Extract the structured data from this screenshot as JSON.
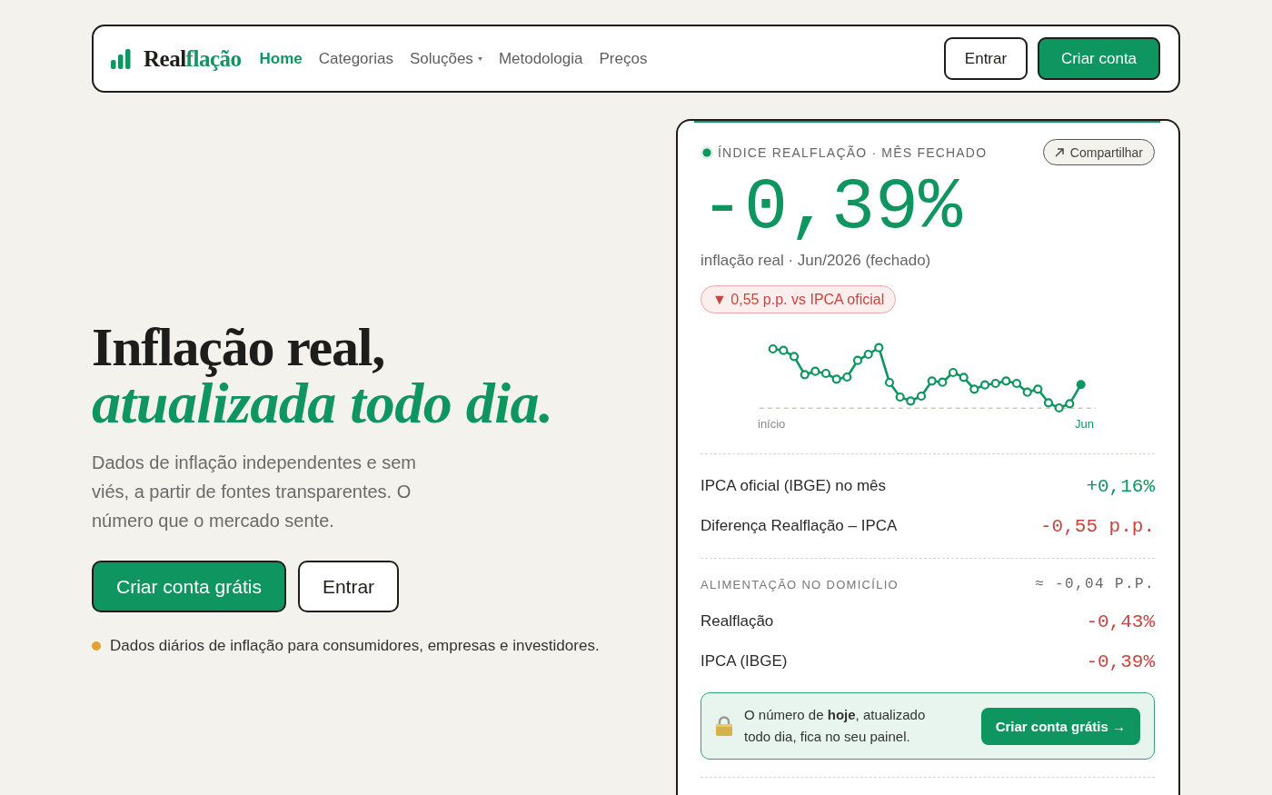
{
  "nav": {
    "logo": {
      "prefix": "Real",
      "accent": "flação"
    },
    "links": [
      {
        "label": "Home",
        "selected": true,
        "dropdown": false
      },
      {
        "label": "Categorias",
        "selected": false,
        "dropdown": false
      },
      {
        "label": "Soluções",
        "selected": false,
        "dropdown": true
      },
      {
        "label": "Metodologia",
        "selected": false,
        "dropdown": false
      },
      {
        "label": "Preços",
        "selected": false,
        "dropdown": false
      }
    ],
    "login": "Entrar",
    "signup": "Criar conta"
  },
  "hero": {
    "headline": "Inflação real, *atualizada todo dia.*",
    "lead": "Dados de inflação independentes e sem viés, a partir de fontes transparentes. O número que o mercado sente.",
    "primary_button": "Criar conta grátis",
    "secondary_button": "Entrar",
    "note": "Dados diários de inflação para consumidores, empresas e investidores."
  },
  "index_card": {
    "eyebrow": "ÍNDICE REALFLAÇÃO · MÊS FECHADO",
    "share_button": "Compartilhar",
    "value": "-0,39%",
    "caption": "inflação real · Jun/2026 (fechado)",
    "comparison": "▼ 0,55 p.p. vs IPCA oficial",
    "sparkline": {
      "start_label": "início",
      "end_label": "Jun"
    },
    "summary": [
      {
        "label": "IPCA oficial (IBGE) no mês",
        "value": "+0,16%",
        "color": "#0f9560"
      },
      {
        "label": "Diferença Realflação – IPCA",
        "value": "-0,55 p.p.",
        "color": "#c8453e"
      }
    ],
    "category": {
      "name": "ALIMENTAÇÃO NO DOMICÍLIO",
      "value": "≈ -0,04 P.P.",
      "rows": [
        {
          "label": "Realflação",
          "value": "-0,43%",
          "color": "#c8453e"
        },
        {
          "label": "IPCA (IBGE)",
          "value": "-0,39%",
          "color": "#c8453e"
        }
      ]
    },
    "cta": {
      "text": "O número de **hoje**, atualizado todo dia, fica no seu painel.",
      "button": "Criar conta grátis →"
    }
  }
}
